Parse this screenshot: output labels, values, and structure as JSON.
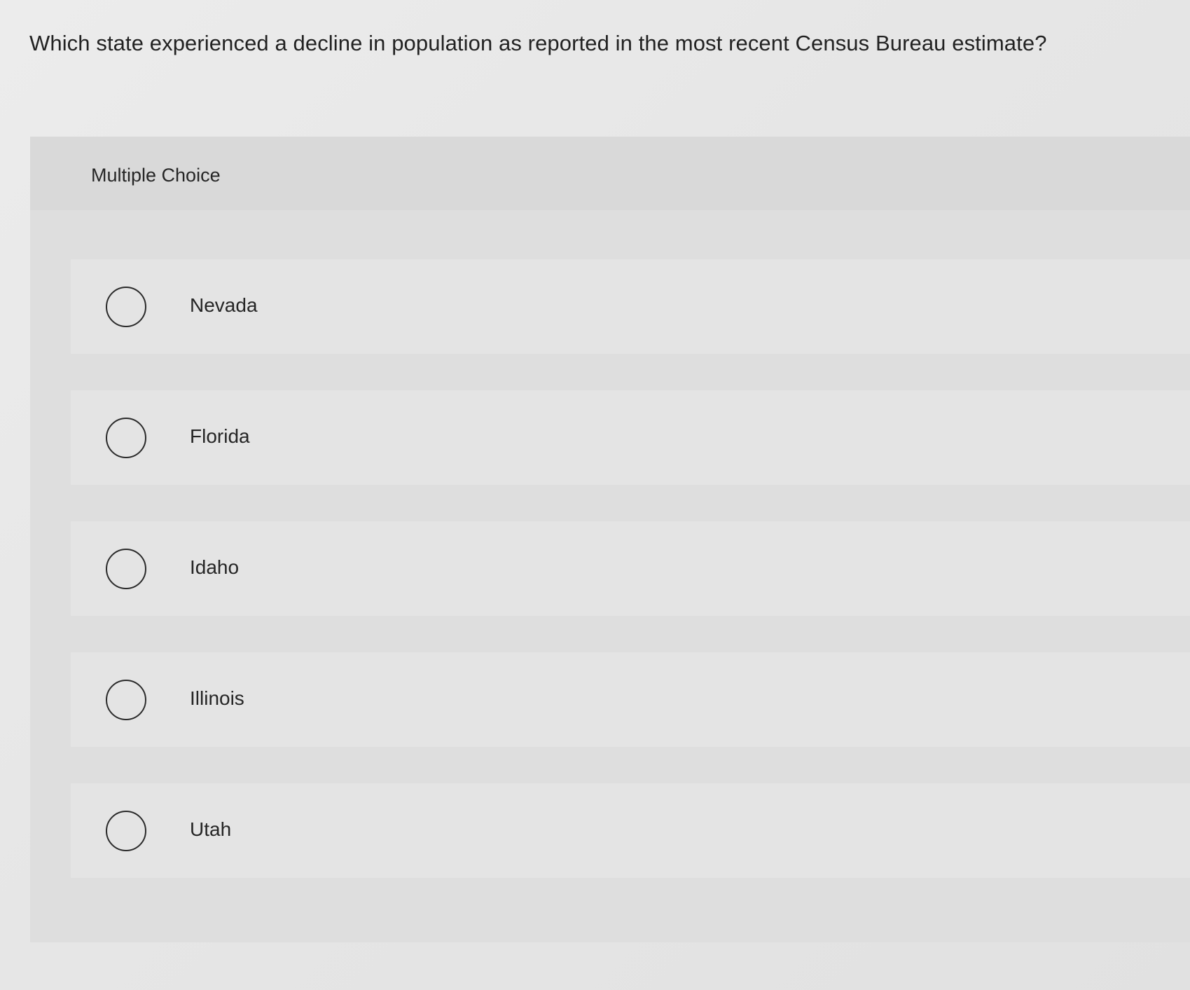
{
  "question": {
    "text": "Which state experienced a decline in population as reported in the most recent Census Bureau estimate?"
  },
  "card": {
    "header_label": "Multiple Choice"
  },
  "choices": [
    {
      "label": "Nevada"
    },
    {
      "label": "Florida"
    },
    {
      "label": "Idaho"
    },
    {
      "label": "Illinois"
    },
    {
      "label": "Utah"
    }
  ],
  "icons": {
    "radio": "radio-unselected-icon"
  }
}
